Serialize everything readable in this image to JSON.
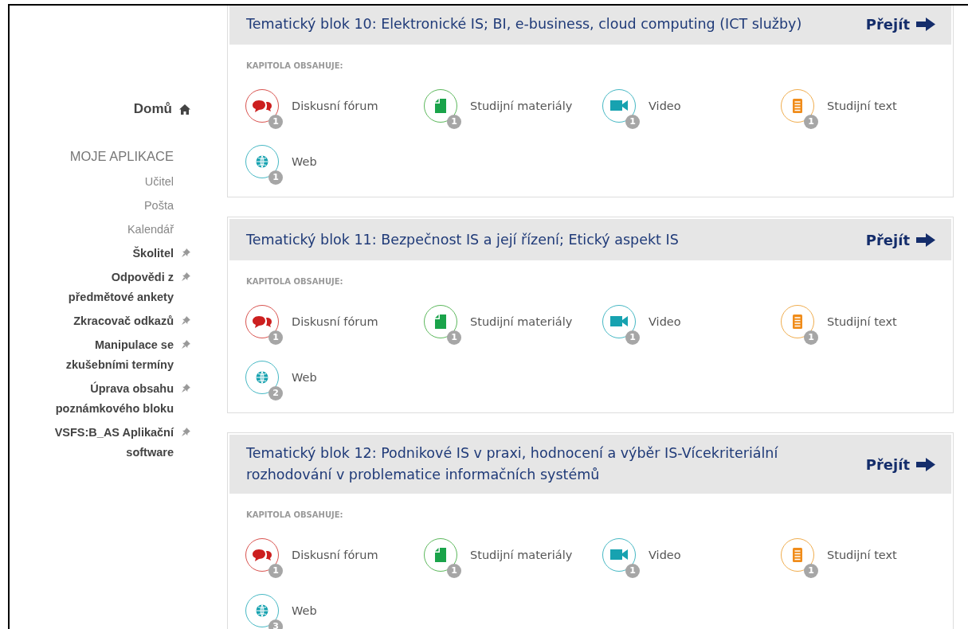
{
  "sidebar": {
    "home": "Domů",
    "section_title": "MOJE APLIKACE",
    "items": [
      {
        "label": "Učitel",
        "pinned": false
      },
      {
        "label": "Pošta",
        "pinned": false
      },
      {
        "label": "Kalendář",
        "pinned": false
      },
      {
        "label": "Školitel",
        "pinned": true
      },
      {
        "label": "Odpovědi z předmětové ankety",
        "pinned": true
      },
      {
        "label": "Zkracovač odkazů",
        "pinned": true
      },
      {
        "label": "Manipulace se zkušebními termíny",
        "pinned": true
      },
      {
        "label": "Úprava obsahu poznámkového bloku",
        "pinned": true
      },
      {
        "label": "VSFS:B_AS Aplikační software",
        "pinned": true
      }
    ]
  },
  "blocks": [
    {
      "title": "Tematický blok 10: Elektronické IS; BI, e-business, cloud computing (ICT služby)",
      "link": "Přejít",
      "contents_label": "KAPITOLA OBSAHUJE:",
      "items": [
        {
          "kind": "forum",
          "label": "Diskusní fórum",
          "count": "1"
        },
        {
          "kind": "materials",
          "label": "Studijní materiály",
          "count": "1"
        },
        {
          "kind": "video",
          "label": "Video",
          "count": "1"
        },
        {
          "kind": "text",
          "label": "Studijní text",
          "count": "1"
        },
        {
          "kind": "web",
          "label": "Web",
          "count": "1"
        }
      ]
    },
    {
      "title": "Tematický blok 11: Bezpečnost IS a její řízení; Etický aspekt IS",
      "link": "Přejít",
      "contents_label": "KAPITOLA OBSAHUJE:",
      "items": [
        {
          "kind": "forum",
          "label": "Diskusní fórum",
          "count": "1"
        },
        {
          "kind": "materials",
          "label": "Studijní materiály",
          "count": "1"
        },
        {
          "kind": "video",
          "label": "Video",
          "count": "1"
        },
        {
          "kind": "text",
          "label": "Studijní text",
          "count": "1"
        },
        {
          "kind": "web",
          "label": "Web",
          "count": "2"
        }
      ]
    },
    {
      "title": "Tematický blok 12: Podnikové IS v praxi, hodnocení a výběr IS-Vícekriteriální rozhodování v problematice informačních systémů",
      "link": "Přejít",
      "contents_label": "KAPITOLA OBSAHUJE:",
      "items": [
        {
          "kind": "forum",
          "label": "Diskusní fórum",
          "count": "1"
        },
        {
          "kind": "materials",
          "label": "Studijní materiály",
          "count": "1"
        },
        {
          "kind": "video",
          "label": "Video",
          "count": "1"
        },
        {
          "kind": "text",
          "label": "Studijní text",
          "count": "1"
        },
        {
          "kind": "web",
          "label": "Web",
          "count": "3"
        }
      ]
    }
  ]
}
